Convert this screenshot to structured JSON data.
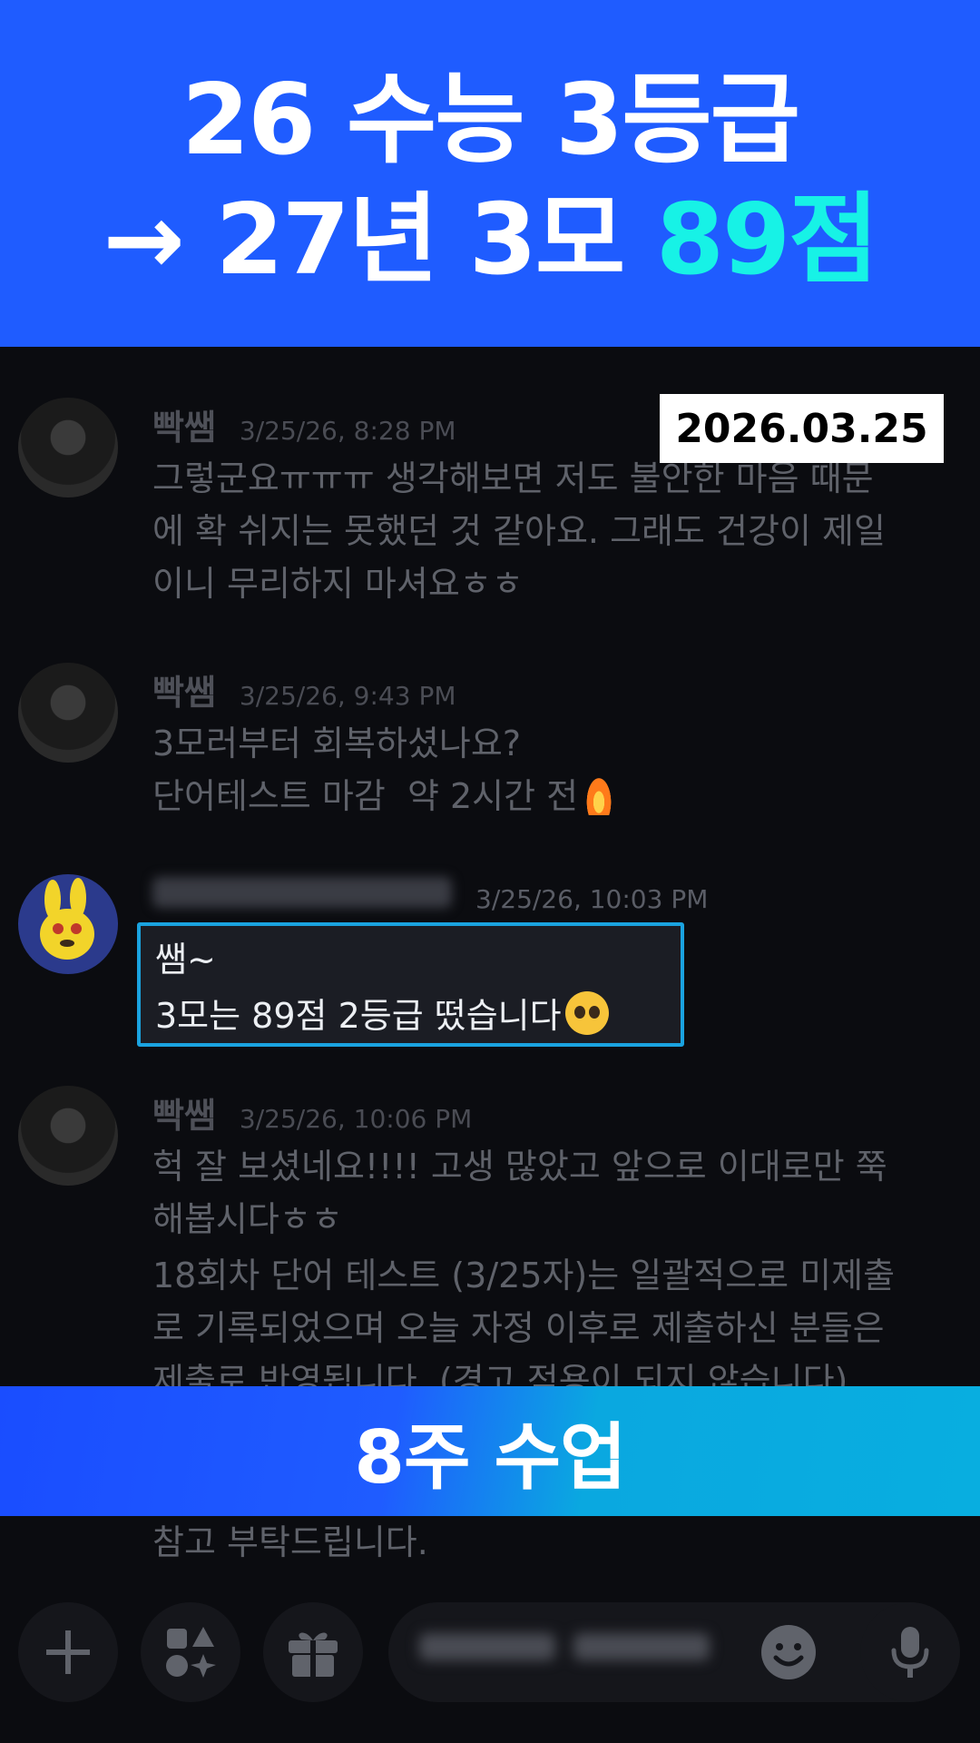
{
  "banner": {
    "line1": "26 수능 3등급",
    "line2_prefix": "→ 27년 3모 ",
    "line2_accent": "89점",
    "accent_color": "#17f2e6",
    "background_color": "#1f5cff"
  },
  "date_badge": "2026.03.25",
  "messages": [
    {
      "sender": "빡쌤",
      "time": "3/25/26, 8:28 PM",
      "text": "그렇군요ㅠㅠㅠ 생각해보면 저도 불안한 마음 때문\n에 확 쉬지는 못했던 것 같아요. 그래도 건강이 제일\n이니 무리하지 마셔요ㅎㅎ"
    },
    {
      "sender": "빡쌤",
      "time": "3/25/26, 9:43 PM",
      "text_line1": "3모러부터 회복하셨나요?",
      "text_line2": "단어테스트 마감  약 2시간 전",
      "emoji": "fire-icon"
    },
    {
      "sender": "",
      "time": "3/25/26, 10:03 PM",
      "text_line1": "쌤~",
      "text_line2": "3모는 89점 2등급 떴습니다",
      "emoji": "pleading-face-icon",
      "highlight_color": "#1aa3e0"
    },
    {
      "sender": "빡쌤",
      "time": "3/25/26, 10:06 PM",
      "text": "헉 잘 보셨네요!!!! 고생 많았고 앞으로 이대로만 쭉\n해봅시다ㅎㅎ",
      "text2": "18회차 단어 테스트 (3/25자)는 일괄적으로 미제출\n로 기록되었으며 오늘 자정 이후로 제출하신 분들은\n제출로 반영됩니다. (경고 적용이 되지 않습니다)",
      "text3": "참고 부탁드립니다."
    }
  ],
  "bottom_banner": "8주 수업",
  "toolbar": {
    "icons": [
      "plus-icon",
      "apps-icon",
      "gift-icon",
      "emoji-icon",
      "microphone-icon"
    ]
  }
}
